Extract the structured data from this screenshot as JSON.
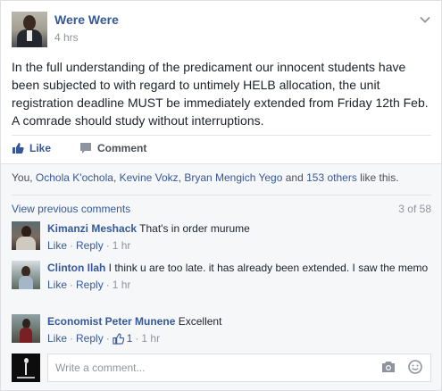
{
  "post": {
    "author": "Were Were",
    "time": "4 hrs",
    "text": "In the full understanding of the predicament our innocent students have been subjected to with regard to untimely HELB allocation, the unit registration deadline MUST be immediately extended from Friday 12th Feb. A comrade should study without interruptions.",
    "menu_icon": "chevron-down-icon"
  },
  "actions": {
    "like_label": "Like",
    "comment_label": "Comment"
  },
  "likes": {
    "prefix": "You, ",
    "names": [
      "Ochola K'ochola",
      "Kevine Vokz",
      "Bryan Mengich Yego"
    ],
    "sep1": ", ",
    "sep2": ", ",
    "and": " and ",
    "others": "153 others",
    "suffix": " like this."
  },
  "comments_header": {
    "view_previous": "View previous comments",
    "count": "3 of 58"
  },
  "comments": [
    {
      "name": "Kimanzi Meshack",
      "text": "That's in order murume",
      "like": "Like",
      "reply": "Reply",
      "time": "1 hr",
      "likes": ""
    },
    {
      "name": "Clinton Ilah",
      "text": "I think u are too late. it has already been extended. I saw the memo",
      "like": "Like",
      "reply": "Reply",
      "time": "1 hr",
      "likes": ""
    },
    {
      "name": "Economist Peter Munene",
      "text": "Excellent",
      "like": "Like",
      "reply": "Reply",
      "time": "1 hr",
      "likes": "1"
    }
  ],
  "reply_box": {
    "placeholder": "Write a comment...",
    "icons": [
      "camera-icon",
      "emoji-icon"
    ]
  },
  "colors": {
    "link": "#365899",
    "muted": "#90949c",
    "text": "#1d2129",
    "ufi_bg": "#f6f7f9"
  }
}
